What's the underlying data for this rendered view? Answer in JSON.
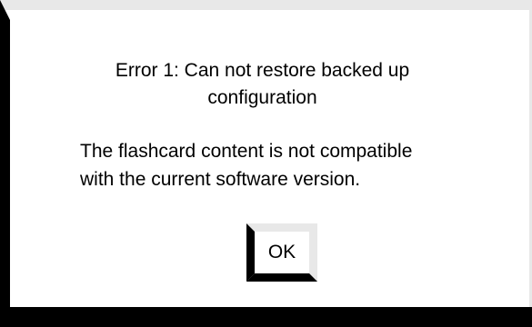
{
  "dialog": {
    "title_lines": [
      "Error 1: Can not restore backed up",
      "configuration"
    ],
    "message_lines": [
      "The flashcard content is not compatible",
      "with the current software version."
    ],
    "ok_label": "OK"
  },
  "colors": {
    "background": "#ffffff",
    "bevel_light": "#e8e8e8",
    "bevel_dark": "#000000",
    "text": "#000000"
  }
}
